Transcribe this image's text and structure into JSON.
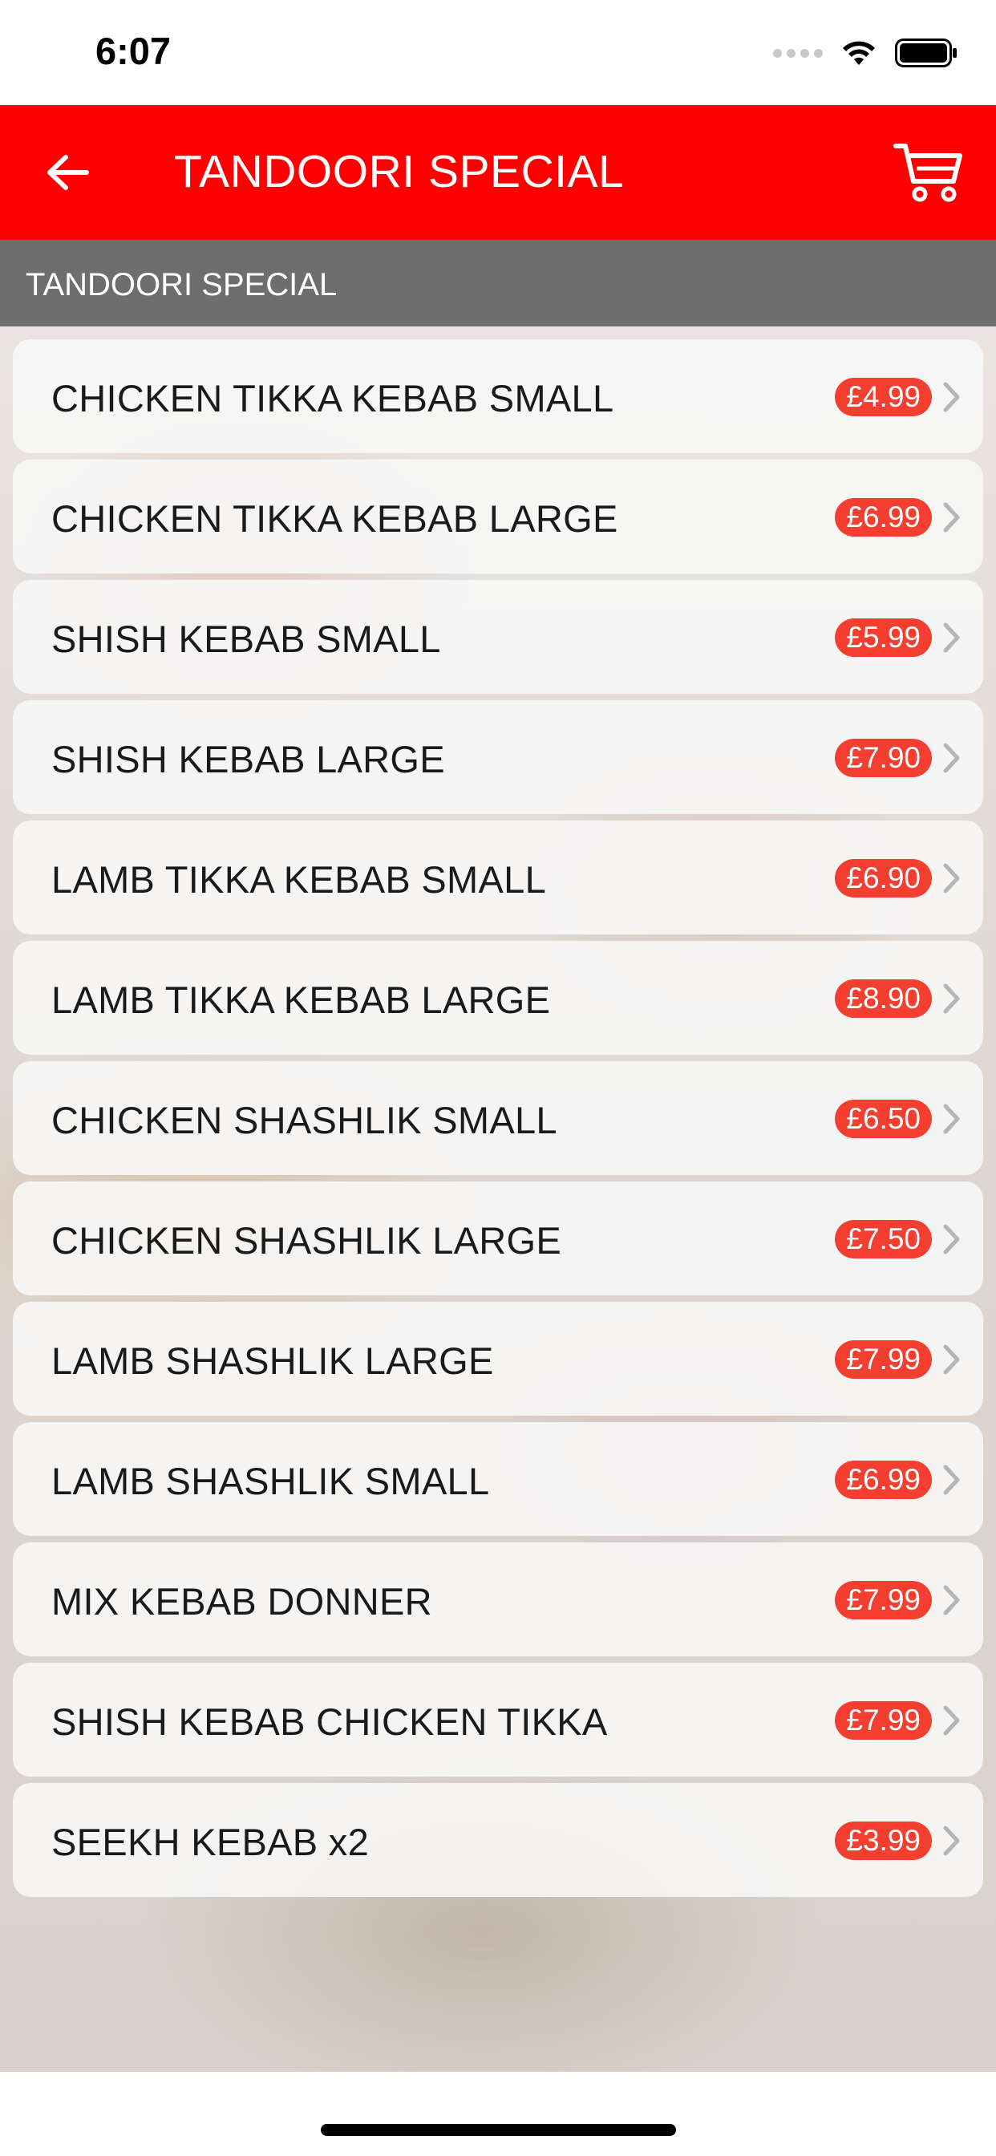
{
  "status_bar": {
    "time": "6:07"
  },
  "nav": {
    "title": "TANDOORI SPECIAL"
  },
  "section": {
    "header": "TANDOORI SPECIAL"
  },
  "colors": {
    "nav_background": "#ff0000",
    "price_badge": "#f43e30",
    "section_header": "#6e6e6e"
  },
  "menu_items": [
    {
      "name": "CHICKEN TIKKA KEBAB SMALL",
      "price": "£4.99"
    },
    {
      "name": "CHICKEN TIKKA KEBAB LARGE",
      "price": "£6.99"
    },
    {
      "name": "SHISH KEBAB SMALL",
      "price": "£5.99"
    },
    {
      "name": "SHISH KEBAB LARGE",
      "price": "£7.90"
    },
    {
      "name": "LAMB TIKKA KEBAB SMALL",
      "price": "£6.90"
    },
    {
      "name": "LAMB TIKKA KEBAB LARGE",
      "price": "£8.90"
    },
    {
      "name": "CHICKEN SHASHLIK SMALL",
      "price": "£6.50"
    },
    {
      "name": "CHICKEN SHASHLIK LARGE",
      "price": "£7.50"
    },
    {
      "name": "LAMB SHASHLIK LARGE",
      "price": "£7.99"
    },
    {
      "name": "LAMB SHASHLIK SMALL",
      "price": "£6.99"
    },
    {
      "name": "MIX KEBAB DONNER",
      "price": "£7.99"
    },
    {
      "name": "SHISH KEBAB CHICKEN TIKKA",
      "price": "£7.99"
    },
    {
      "name": "SEEKH KEBAB x2",
      "price": "£3.99"
    }
  ]
}
